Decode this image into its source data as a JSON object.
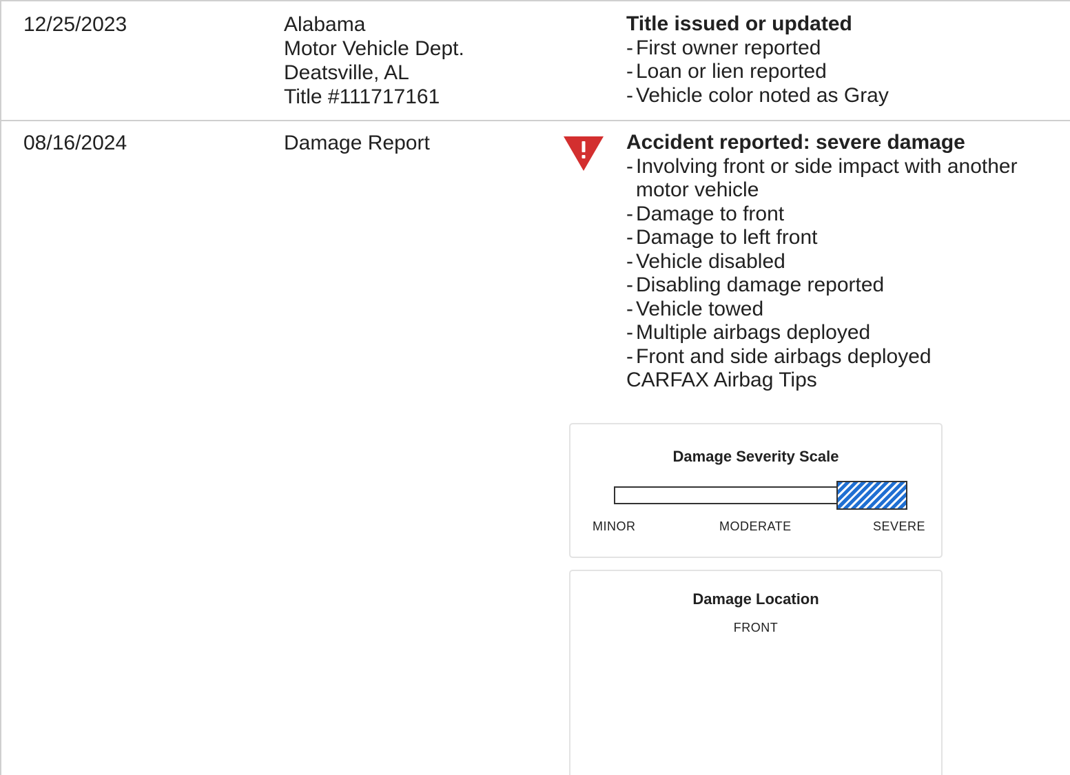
{
  "records": [
    {
      "date": "12/25/2023",
      "source": [
        "Alabama",
        "Motor Vehicle Dept.",
        "Deatsville, AL",
        "Title #111717161"
      ],
      "heading": "Title issued or updated",
      "items": [
        "First owner reported",
        "Loan or lien reported",
        "Vehicle color noted as Gray"
      ]
    },
    {
      "date": "08/16/2024",
      "source": [
        "Damage Report"
      ],
      "alert_icon": "warning-triangle-icon",
      "heading": "Accident reported: severe damage",
      "items": [
        "Involving front or side impact with another motor vehicle",
        "Damage to front",
        "Damage to left front",
        "Vehicle disabled",
        "Disabling damage reported",
        "Vehicle towed",
        "Multiple airbags deployed",
        "Front and side airbags deployed"
      ],
      "link": "CARFAX Airbag Tips"
    }
  ],
  "severity_scale": {
    "title": "Damage Severity Scale",
    "labels": [
      "MINOR",
      "MODERATE",
      "SEVERE"
    ],
    "level": "SEVERE",
    "fill_start_fraction": 0.765,
    "fill_end_fraction": 1.0
  },
  "damage_location": {
    "title": "Damage Location",
    "value": "FRONT"
  },
  "colors": {
    "alert": "#d32f2f",
    "severity_fill": "#1f6fd2",
    "divider": "#cfcfcf"
  }
}
